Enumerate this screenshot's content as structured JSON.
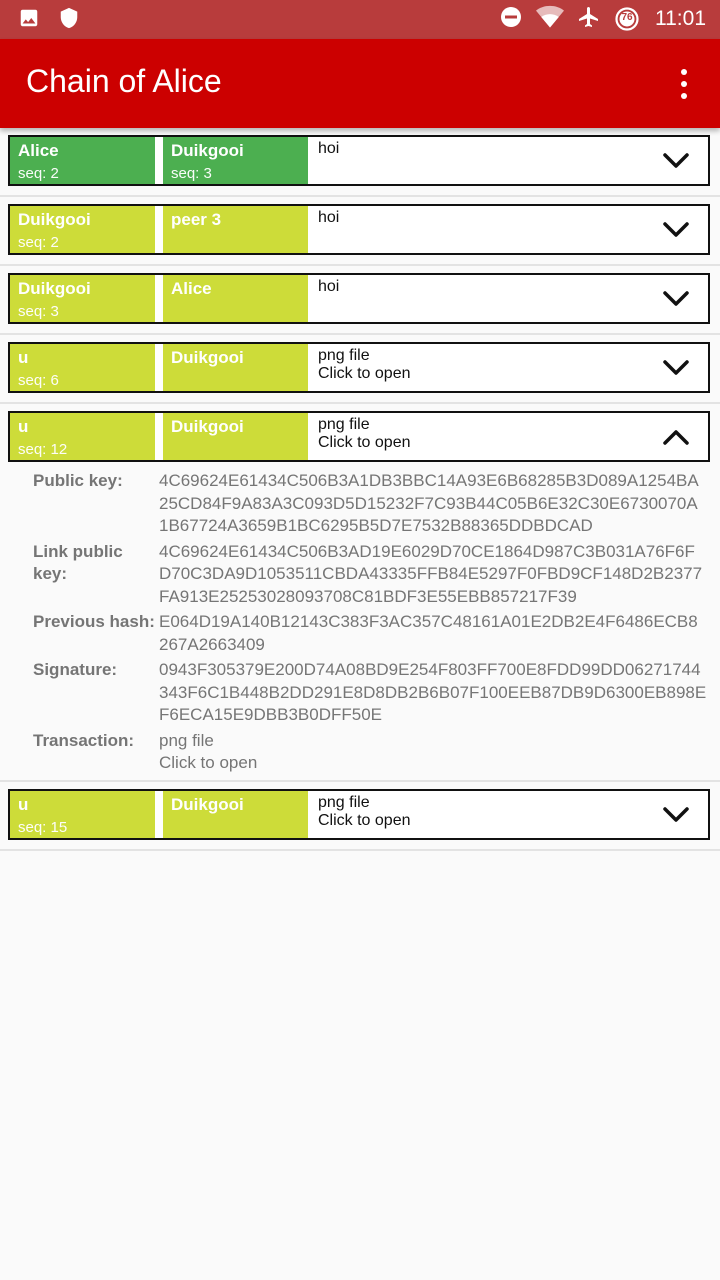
{
  "status": {
    "time": "11:01",
    "battery": "76",
    "left_icons": [
      "image-icon",
      "shield-icon"
    ],
    "right_icons": [
      "do-not-disturb-icon",
      "wifi-icon",
      "airplane-icon",
      "battery-saver-icon"
    ]
  },
  "app_bar": {
    "title": "Chain of Alice",
    "menu_icon": "more-vert-icon"
  },
  "blocks": [
    {
      "peer1": "Alice",
      "seq1": "seq: 2",
      "peer2": "Duikgooi",
      "seq2": "seq: 3",
      "tx_line1": "hoi",
      "tx_line2": "",
      "color": "#4caf50",
      "expanded": false
    },
    {
      "peer1": "Duikgooi",
      "seq1": "seq: 2",
      "peer2": "peer 3",
      "seq2": "",
      "tx_line1": "hoi",
      "tx_line2": "",
      "color": "#cddc39",
      "expanded": false
    },
    {
      "peer1": "Duikgooi",
      "seq1": "seq: 3",
      "peer2": "Alice",
      "seq2": "",
      "tx_line1": "hoi",
      "tx_line2": "",
      "color": "#cddc39",
      "expanded": false
    },
    {
      "peer1": "u",
      "seq1": "seq: 6",
      "peer2": "Duikgooi",
      "seq2": "",
      "tx_line1": "png file",
      "tx_line2": "Click to open",
      "color": "#cddc39",
      "expanded": false
    },
    {
      "peer1": "u",
      "seq1": "seq: 12",
      "peer2": "Duikgooi",
      "seq2": "",
      "tx_line1": "png file",
      "tx_line2": "Click to open",
      "color": "#cddc39",
      "expanded": true
    },
    {
      "peer1": "u",
      "seq1": "seq: 15",
      "peer2": "Duikgooi",
      "seq2": "",
      "tx_line1": "png file",
      "tx_line2": "Click to open",
      "color": "#cddc39",
      "expanded": false
    }
  ],
  "details": {
    "public_key_label": "Public key:",
    "public_key": "4C69624E61434C506B3A1DB3BBC14A93E6B68285B3D089A1254BA25CD84F9A83A3C093D5D15232F7C93B44C05B6E32C30E6730070A1B67724A3659B1BC6295B5D7E7532B88365DDBDCAD",
    "link_public_key_label": "Link public key:",
    "link_public_key": "4C69624E61434C506B3AD19E6029D70CE1864D987C3B031A76F6FD70C3DA9D1053511CBDA43335FFB84E5297F0FBD9CF148D2B2377FA913E25253028093708C81BDF3E55EBB857217F39",
    "previous_hash_label": "Previous hash:",
    "previous_hash": "E064D19A140B12143C383F3AC357C48161A01E2DB2E4F6486ECB8267A2663409",
    "signature_label": "Signature:",
    "signature": "0943F305379E200D74A08BD9E254F803FF700E8FDD99DD06271744343F6C1B448B2DD291E8D8DB2B6B07F100EEB87DB9D6300EB898EF6ECA15E9DBB3B0DFF50E",
    "transaction_label": "Transaction:",
    "transaction_line1": "png file",
    "transaction_line2": "Click to open"
  }
}
